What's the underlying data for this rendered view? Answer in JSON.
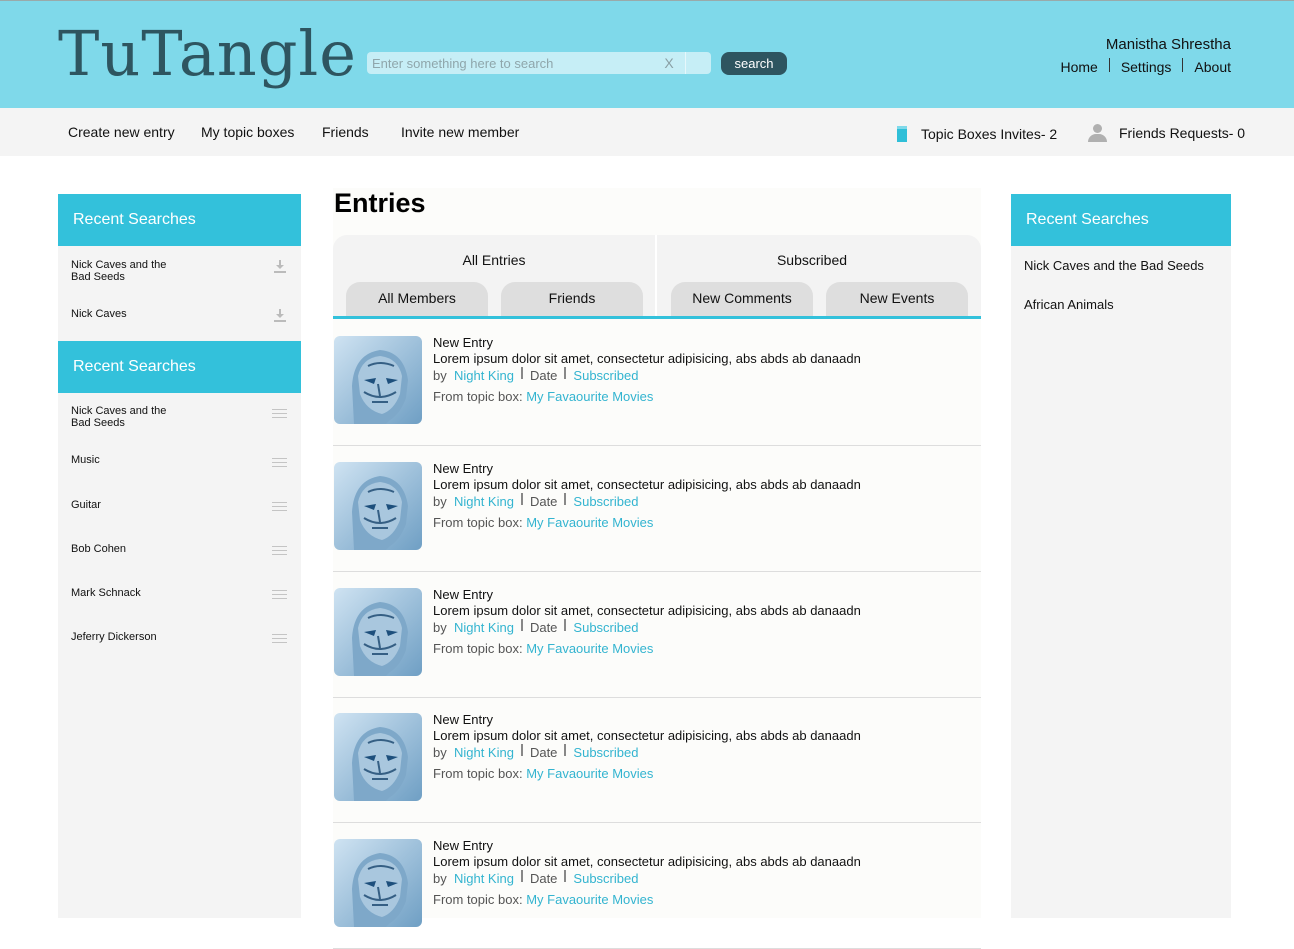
{
  "header": {
    "logo": "TuTangle",
    "search_placeholder": "Enter something here to search",
    "clear_label": "X",
    "search_label": "search",
    "user_name": "Manistha Shrestha",
    "nav": [
      "Home",
      "Settings",
      "About"
    ]
  },
  "subnav": {
    "items": [
      "Create new entry",
      "My topic boxes",
      "Friends",
      "Invite new member"
    ],
    "invites": "Topic Boxes Invites- 2",
    "requests": "Friends Requests- 0"
  },
  "left": {
    "panel1_title": "Recent Searches",
    "panel1_items": [
      {
        "line1": "Nick Caves and the",
        "line2": "Bad Seeds"
      },
      {
        "line1": "Nick Caves",
        "line2": ""
      }
    ],
    "panel2_title": "Recent Searches",
    "panel2_items": [
      {
        "line1": "Nick Caves and the",
        "line2": "Bad Seeds"
      },
      {
        "line1": "Music",
        "line2": ""
      },
      {
        "line1": "Guitar",
        "line2": ""
      },
      {
        "line1": "Bob Cohen",
        "line2": ""
      },
      {
        "line1": "Mark Schnack",
        "line2": ""
      },
      {
        "line1": "Jeferry Dickerson",
        "line2": ""
      }
    ]
  },
  "main": {
    "title": "Entries",
    "tabs_top": [
      "All Entries",
      "Subscribed"
    ],
    "tabs_sub": [
      "All Members",
      "Friends",
      "New Comments",
      "New Events"
    ],
    "entries": [
      {
        "title": "New Entry",
        "desc": "Lorem ipsum dolor sit amet, consectetur adipisicing, abs abds ab danaadn",
        "by": "by",
        "author": "Night King",
        "date": "Date",
        "status": "Subscribed",
        "topic_label": "From topic box:",
        "topic": "My Favaourite Movies"
      },
      {
        "title": "New Entry",
        "desc": "Lorem ipsum dolor sit amet, consectetur adipisicing, abs abds ab danaadn",
        "by": "by",
        "author": "Night King",
        "date": "Date",
        "status": "Subscribed",
        "topic_label": "From topic box:",
        "topic": "My Favaourite Movies"
      },
      {
        "title": "New Entry",
        "desc": "Lorem ipsum dolor sit amet, consectetur adipisicing, abs abds ab danaadn",
        "by": "by",
        "author": "Night King",
        "date": "Date",
        "status": "Subscribed",
        "topic_label": "From topic box:",
        "topic": "My Favaourite Movies"
      },
      {
        "title": "New Entry",
        "desc": "Lorem ipsum dolor sit amet, consectetur adipisicing, abs abds ab danaadn",
        "by": "by",
        "author": "Night King",
        "date": "Date",
        "status": "Subscribed",
        "topic_label": "From topic box:",
        "topic": "My Favaourite Movies"
      },
      {
        "title": "New Entry",
        "desc": "Lorem ipsum dolor sit amet, consectetur adipisicing, abs abds ab danaadn",
        "by": "by",
        "author": "Night King",
        "date": "Date",
        "status": "Subscribed",
        "topic_label": "From topic box:",
        "topic": "My Favaourite Movies"
      }
    ]
  },
  "right": {
    "title": "Recent Searches",
    "items": [
      "Nick Caves and the Bad Seeds",
      "African Animals"
    ]
  },
  "colors": {
    "header_bg": "#7fd9ea",
    "accent": "#33c1db",
    "link": "#33b4d0",
    "logo": "#2e5560",
    "button": "#2e5560"
  }
}
